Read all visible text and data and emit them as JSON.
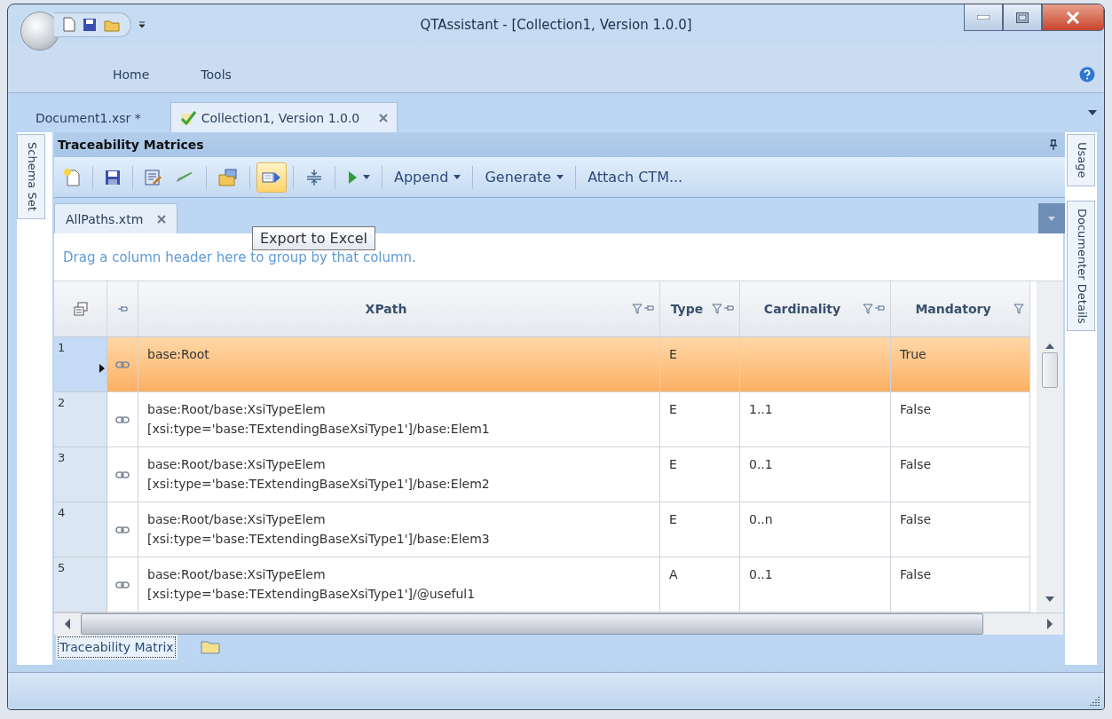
{
  "window": {
    "title": "QTAssistant - [Collection1, Version 1.0.0]"
  },
  "menu": [
    "Home",
    "Tools"
  ],
  "document_tabs": [
    {
      "label": "Document1.xsr *",
      "selected": false,
      "closable": false
    },
    {
      "label": "Collection1, Version 1.0.0",
      "selected": true,
      "closable": true
    }
  ],
  "left_side_tabs": [
    "Schema Set"
  ],
  "right_side_tabs": [
    "Usage",
    "Documenter Details"
  ],
  "panel": {
    "title": "Traceability Matrices",
    "toolbar": [
      {
        "kind": "icon",
        "hovered": false
      },
      {
        "kind": "separator"
      },
      {
        "kind": "icon",
        "hovered": false
      },
      {
        "kind": "separator"
      },
      {
        "kind": "icon",
        "hovered": false
      },
      {
        "kind": "icon",
        "hovered": false
      },
      {
        "kind": "separator"
      },
      {
        "kind": "icon",
        "hovered": false
      },
      {
        "kind": "separator"
      },
      {
        "kind": "icon",
        "hovered": true
      },
      {
        "kind": "separator"
      },
      {
        "kind": "icon",
        "hovered": false
      },
      {
        "kind": "separator"
      },
      {
        "kind": "split",
        "hovered": false
      },
      {
        "kind": "separator"
      },
      {
        "kind": "menu",
        "label": "Append",
        "hovered": false
      },
      {
        "kind": "separator"
      },
      {
        "kind": "menu",
        "label": "Generate",
        "hovered": false
      },
      {
        "kind": "separator"
      },
      {
        "kind": "button",
        "label": "Attach CTM...",
        "hovered": false
      }
    ],
    "tooltip": "Export to Excel",
    "inner_tabs": [
      {
        "label": "AllPaths.xtm",
        "selected": true
      }
    ],
    "group_hint": "Drag a column header here to group by that column.",
    "table": {
      "columns": [
        {
          "label": "XPath"
        },
        {
          "label": "Type"
        },
        {
          "label": "Cardinality"
        },
        {
          "label": "Mandatory"
        }
      ],
      "rows": [
        {
          "number": "1",
          "selected": true,
          "xpath": [
            "base:Root"
          ],
          "type": "E",
          "mandatory": "True"
        },
        {
          "number": "2",
          "selected": false,
          "xpath": [
            "base:Root/base:XsiTypeElem",
            "[xsi:type='base:TExtendingBaseXsiType1']/base:Elem1"
          ],
          "type": "E",
          "cardinality": "1..1",
          "mandatory": "False"
        },
        {
          "number": "3",
          "selected": false,
          "xpath": [
            "base:Root/base:XsiTypeElem",
            "[xsi:type='base:TExtendingBaseXsiType1']/base:Elem2"
          ],
          "type": "E",
          "cardinality": "0..1",
          "mandatory": "False"
        },
        {
          "number": "4",
          "selected": false,
          "xpath": [
            "base:Root/base:XsiTypeElem",
            "[xsi:type='base:TExtendingBaseXsiType1']/base:Elem3"
          ],
          "type": "E",
          "cardinality": "0..n",
          "mandatory": "False"
        },
        {
          "number": "5",
          "selected": false,
          "xpath": [
            "base:Root/base:XsiTypeElem",
            "[xsi:type='base:TExtendingBaseXsiType1']/@useful1"
          ],
          "type": "A",
          "cardinality": "0..1",
          "mandatory": "False"
        }
      ]
    },
    "bottom_tabs": [
      {
        "kind": "text",
        "label": "Traceability Matrix",
        "selected": true
      },
      {
        "kind": "folder",
        "selected": false
      }
    ]
  }
}
